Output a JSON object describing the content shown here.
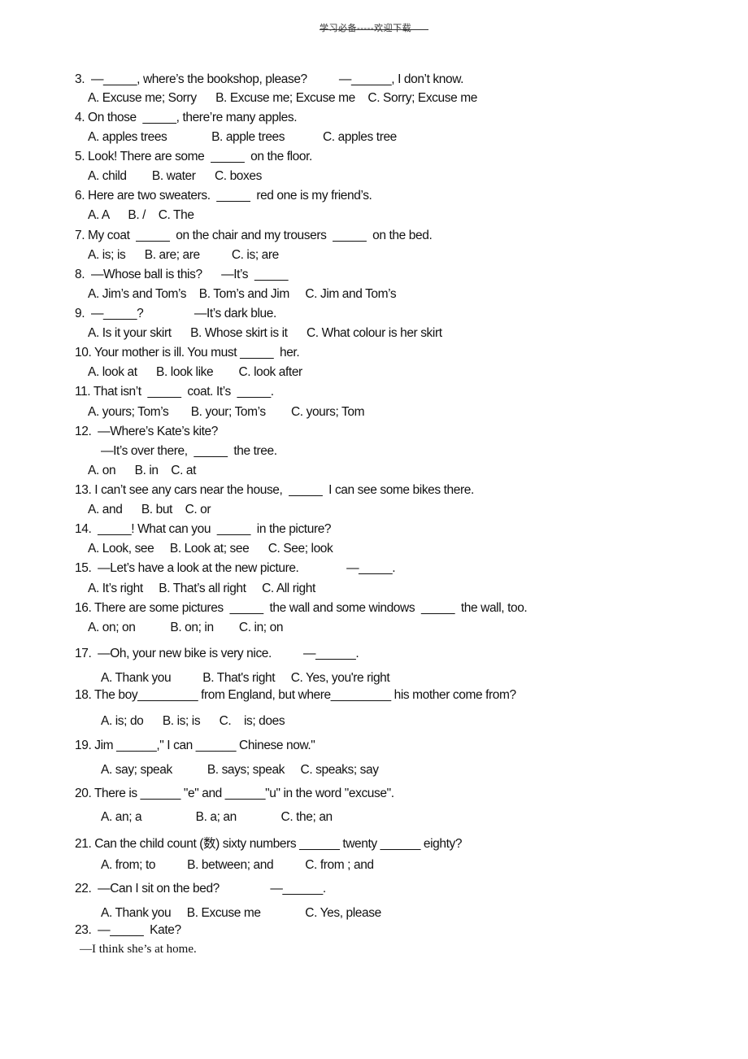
{
  "header": {
    "left": "学习必备",
    "dashes": "-----",
    "right": "欢迎下载"
  },
  "lines": [
    {
      "id": "q3",
      "text": "3.  —_____, where’s the bookshop, please?          —______, I don’t know."
    },
    {
      "id": "q3-options",
      "text": "A. Excuse me; Sorry      B. Excuse me; Excuse me    C. Sorry; Excuse me"
    },
    {
      "id": "q4",
      "text": "4. On those  _____, there’re many apples."
    },
    {
      "id": "q4-options",
      "text": "A. apples trees              B. apple trees            C. apples tree"
    },
    {
      "id": "q5",
      "text": "5. Look! There are some  _____  on the floor."
    },
    {
      "id": "q5-options",
      "text": "A. child        B. water      C. boxes"
    },
    {
      "id": "q6",
      "text": "6. Here are two sweaters.  _____  red one is my friend’s."
    },
    {
      "id": "q6-options",
      "text": "A. A      B. /    C. The"
    },
    {
      "id": "q7",
      "text": "7. My coat  _____  on the chair and my trousers  _____  on the bed."
    },
    {
      "id": "q7-options",
      "text": "A. is; is      B. are; are          C. is; are"
    },
    {
      "id": "q8",
      "text": "8.  —Whose ball is this?      —It’s  _____"
    },
    {
      "id": "q8-options",
      "text": "A. Jim’s and Tom’s    B. Tom’s and Jim     C. Jim and Tom’s"
    },
    {
      "id": "q9",
      "text": "9.  —_____?                —It’s dark blue."
    },
    {
      "id": "q9-options",
      "text": "A. Is it your skirt      B. Whose skirt is it      C. What colour is her skirt"
    },
    {
      "id": "q10",
      "text": "10. Your mother is ill. You must _____  her."
    },
    {
      "id": "q10-options",
      "text": "A. look at      B. look like        C. look after"
    },
    {
      "id": "q11",
      "text": "11. That isn’t  _____  coat. It’s  _____."
    },
    {
      "id": "q11-options",
      "text": "A. yours; Tom’s       B. your; Tom’s        C. yours; Tom"
    },
    {
      "id": "q12",
      "text": "12.  —Where’s Kate’s kite?"
    },
    {
      "id": "q12-answer",
      "text": "—It’s over there,  _____  the tree."
    },
    {
      "id": "q12-options",
      "text": "A. on      B. in    C. at"
    },
    {
      "id": "q13",
      "text": "13. I can’t see any cars near the house,  _____  I can see some bikes there."
    },
    {
      "id": "q13-options",
      "text": "A. and      B. but    C. or"
    },
    {
      "id": "q14",
      "text": "14.  _____! What can you  _____  in the picture?"
    },
    {
      "id": "q14-options",
      "text": "A. Look, see     B. Look at; see      C. See; look"
    },
    {
      "id": "q15",
      "text": "15.  —Let’s have a look at the new picture.               —_____."
    },
    {
      "id": "q15-options",
      "text": "A. It’s right     B. That’s all right     C. All right"
    },
    {
      "id": "q16",
      "text": "16. There are some pictures  _____  the wall and some windows  _____  the wall, too."
    },
    {
      "id": "q16-options",
      "text": "A. on; on           B. on; in        C. in; on"
    },
    {
      "id": "q17",
      "text": "17.  —Oh, your new bike is very nice.          —______."
    },
    {
      "id": "q17-options",
      "text": "A. Thank you          B. That's right     C. Yes, you're right"
    },
    {
      "id": "q18",
      "text": "18. The boy_________ from England, but where_________ his mother come from?"
    },
    {
      "id": "q18-options",
      "text": "A. is; do      B. is; is      C.    is; does"
    },
    {
      "id": "q19",
      "text": "19. Jim ______,\" I can ______ Chinese now.\""
    },
    {
      "id": "q19-options",
      "text": "A. say; speak           B. says; speak     C. speaks; say"
    },
    {
      "id": "q20",
      "text": "20. There is ______ \"e\" and ______\"u\" in the word \"excuse\"."
    },
    {
      "id": "q20-options",
      "text": "A. an; a                 B. a; an              C. the; an"
    },
    {
      "id": "q21",
      "text": "21. Can the child count (数) sixty numbers ______ twenty ______ eighty?"
    },
    {
      "id": "q21-options",
      "text": "A. from; to          B. between; and          C. from ; and"
    },
    {
      "id": "q22",
      "text": "22.  —Can I sit on the bed?                —______."
    },
    {
      "id": "q22-options",
      "text": "A. Thank you     B. Excuse me              C. Yes, please"
    },
    {
      "id": "q23",
      "text": "23.  —_____  Kate?"
    },
    {
      "id": "q23-answer",
      "text": "—I think she’s at home."
    }
  ]
}
